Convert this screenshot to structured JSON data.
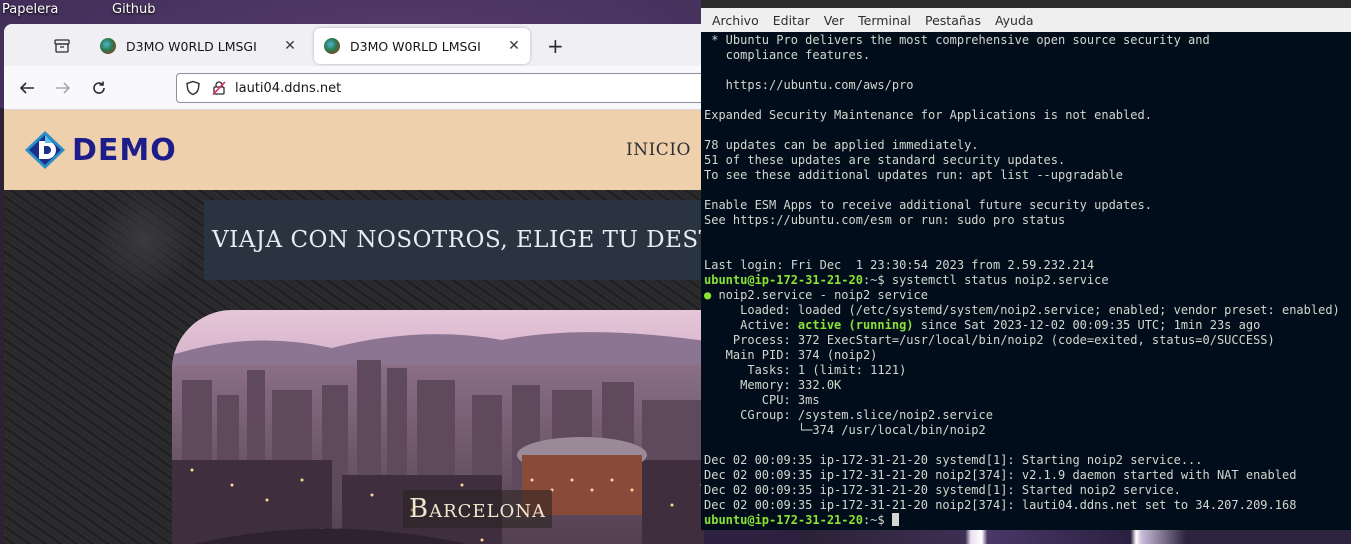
{
  "desktop": {
    "icons": [
      {
        "label": "Papelera"
      },
      {
        "label": "Github"
      }
    ]
  },
  "browser": {
    "tabs": [
      {
        "title": "D3MO W0RLD LMSGI",
        "active": false
      },
      {
        "title": "D3MO W0RLD LMSGI",
        "active": true
      }
    ],
    "url": "lauti04.ddns.net",
    "page": {
      "logo_text": "DEMO",
      "nav_item": "INICIO",
      "hero_text": "VIAJA CON NOSOTROS, ELIGE TU DEST",
      "city_label": "Barcelona"
    }
  },
  "terminal": {
    "menu": [
      "Archivo",
      "Editar",
      "Ver",
      "Terminal",
      "Pestañas",
      "Ayuda"
    ],
    "lines": [
      " * Ubuntu Pro delivers the most comprehensive open source security and",
      "   compliance features.",
      "",
      "   https://ubuntu.com/aws/pro",
      "",
      "Expanded Security Maintenance for Applications is not enabled.",
      "",
      "78 updates can be applied immediately.",
      "51 of these updates are standard security updates.",
      "To see these additional updates run: apt list --upgradable",
      "",
      "Enable ESM Apps to receive additional future security updates.",
      "See https://ubuntu.com/esm or run: sudo pro status",
      "",
      "",
      "Last login: Fri Dec  1 23:30:54 2023 from 2.59.232.214"
    ],
    "prompt_user": "ubuntu@ip-172-31-21-20",
    "prompt_suffix": ":~$ ",
    "command": "systemctl status noip2.service",
    "service_header": "noip2.service - noip2 service",
    "status": {
      "loaded": "     Loaded: loaded (/etc/systemd/system/noip2.service; enabled; vendor preset: enabled)",
      "active_prefix": "     Active: ",
      "active_state": "active (running)",
      "active_suffix": " since Sat 2023-12-02 00:09:35 UTC; 1min 23s ago",
      "process": "    Process: 372 ExecStart=/usr/local/bin/noip2 (code=exited, status=0/SUCCESS)",
      "main_pid": "   Main PID: 374 (noip2)",
      "tasks": "      Tasks: 1 (limit: 1121)",
      "memory": "     Memory: 332.0K",
      "cpu": "        CPU: 3ms",
      "cgroup": "     CGroup: /system.slice/noip2.service",
      "cgroup_child": "             └─374 /usr/local/bin/noip2"
    },
    "log_lines": [
      "Dec 02 00:09:35 ip-172-31-21-20 systemd[1]: Starting noip2 service...",
      "Dec 02 00:09:35 ip-172-31-21-20 noip2[374]: v2.1.9 daemon started with NAT enabled",
      "Dec 02 00:09:35 ip-172-31-21-20 systemd[1]: Started noip2 service.",
      "Dec 02 00:09:35 ip-172-31-21-20 noip2[374]: lauti04.ddns.net set to 34.207.209.168"
    ]
  }
}
